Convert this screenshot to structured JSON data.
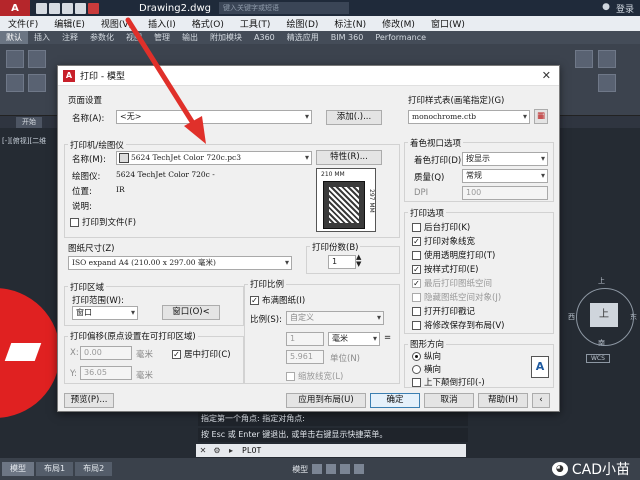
{
  "app": {
    "logo": "A",
    "document_title": "Drawing2.dwg",
    "search_placeholder": "键入关键字或短语",
    "user": "登录"
  },
  "menu": [
    "文件(F)",
    "编辑(E)",
    "视图(V)",
    "插入(I)",
    "格式(O)",
    "工具(T)",
    "绘图(D)",
    "标注(N)",
    "修改(M)",
    "窗口(W)"
  ],
  "ribbon_tabs": [
    "默认",
    "插入",
    "注释",
    "参数化",
    "视图",
    "管理",
    "输出",
    "附加模块",
    "A360",
    "精选应用",
    "BIM 360",
    "Performance"
  ],
  "doc_tab": "开始",
  "view_label": "[-][俯视][二维",
  "viewcube": {
    "north": "上",
    "south": "南",
    "west": "西",
    "east": "东",
    "face": "上",
    "wcs": "WCS"
  },
  "command": {
    "history": [
      "指定第一个角点: 指定对角点:",
      "按 Esc 或 Enter 键退出, 或单击右键显示快捷菜单。"
    ],
    "current": "PLOT"
  },
  "status": {
    "layout_tabs": [
      "模型",
      "布局1",
      "布局2"
    ],
    "mode": "模型",
    "brand": "CAD小苗"
  },
  "dialog": {
    "title": "打印 - 模型",
    "page_setup": {
      "group": "页面设置",
      "name_label": "名称(A):",
      "name_value": "<无>",
      "add_button": "添加(.)..."
    },
    "plotter": {
      "group": "打印机/绘图仪",
      "name_label": "名称(M):",
      "name_value": "5624 TechJet Color 720c.pc3",
      "properties_button": "特性(R)...",
      "plotter_label": "绘图仪:",
      "plotter_value": "5624 TechJet Color 720c -",
      "location_label": "位置:",
      "location_value": "IR",
      "description_label": "说明:",
      "plot_to_file": "打印到文件(F)",
      "preview_width": "210 MM",
      "preview_height": "297 MM"
    },
    "paper_size": {
      "group": "图纸尺寸(Z)",
      "value": "ISO expand A4 (210.00 x 297.00 毫米)"
    },
    "copies": {
      "group": "打印份数(B)",
      "value": "1"
    },
    "plot_area": {
      "group": "打印区域",
      "range_label": "打印范围(W):",
      "range_value": "窗口",
      "window_button": "窗口(O)<"
    },
    "plot_offset": {
      "group": "打印偏移(原点设置在可打印区域)",
      "x_label": "X:",
      "x_value": "0.00",
      "x_unit": "毫米",
      "y_label": "Y:",
      "y_value": "36.05",
      "y_unit": "毫米",
      "center_plot": "居中打印(C)"
    },
    "plot_scale": {
      "group": "打印比例",
      "fit_to_paper": "布满图纸(I)",
      "scale_label": "比例(S):",
      "scale_value": "自定义",
      "value1": "1",
      "unit1": "毫米",
      "value2": "5.961",
      "unit2": "单位(N)",
      "scale_lineweights": "缩放线宽(L)"
    },
    "plot_style": {
      "group": "打印样式表(画笔指定)(G)",
      "value": "monochrome.ctb"
    },
    "shaded_viewport": {
      "group": "着色视口选项",
      "shade_label": "着色打印(D)",
      "shade_value": "按显示",
      "quality_label": "质量(Q)",
      "quality_value": "常规",
      "dpi_label": "DPI",
      "dpi_value": "100"
    },
    "plot_options": {
      "group": "打印选项",
      "items": [
        {
          "label": "后台打印(K)",
          "checked": false,
          "enabled": true
        },
        {
          "label": "打印对象线宽",
          "checked": true,
          "enabled": true
        },
        {
          "label": "使用透明度打印(T)",
          "checked": false,
          "enabled": true
        },
        {
          "label": "按样式打印(E)",
          "checked": true,
          "enabled": true
        },
        {
          "label": "最后打印图纸空间",
          "checked": true,
          "enabled": false
        },
        {
          "label": "隐藏图纸空间对象(J)",
          "checked": false,
          "enabled": false
        },
        {
          "label": "打开打印戳记",
          "checked": false,
          "enabled": true
        },
        {
          "label": "将修改保存到布局(V)",
          "checked": false,
          "enabled": true
        }
      ]
    },
    "orientation": {
      "group": "图形方向",
      "portrait": "纵向",
      "landscape": "横向",
      "upside_down": "上下颠倒打印(-)",
      "icon_letter": "A"
    },
    "buttons": {
      "preview": "预览(P)...",
      "apply_to_layout": "应用到布局(U)",
      "ok": "确定",
      "cancel": "取消",
      "help": "帮助(H)"
    }
  }
}
